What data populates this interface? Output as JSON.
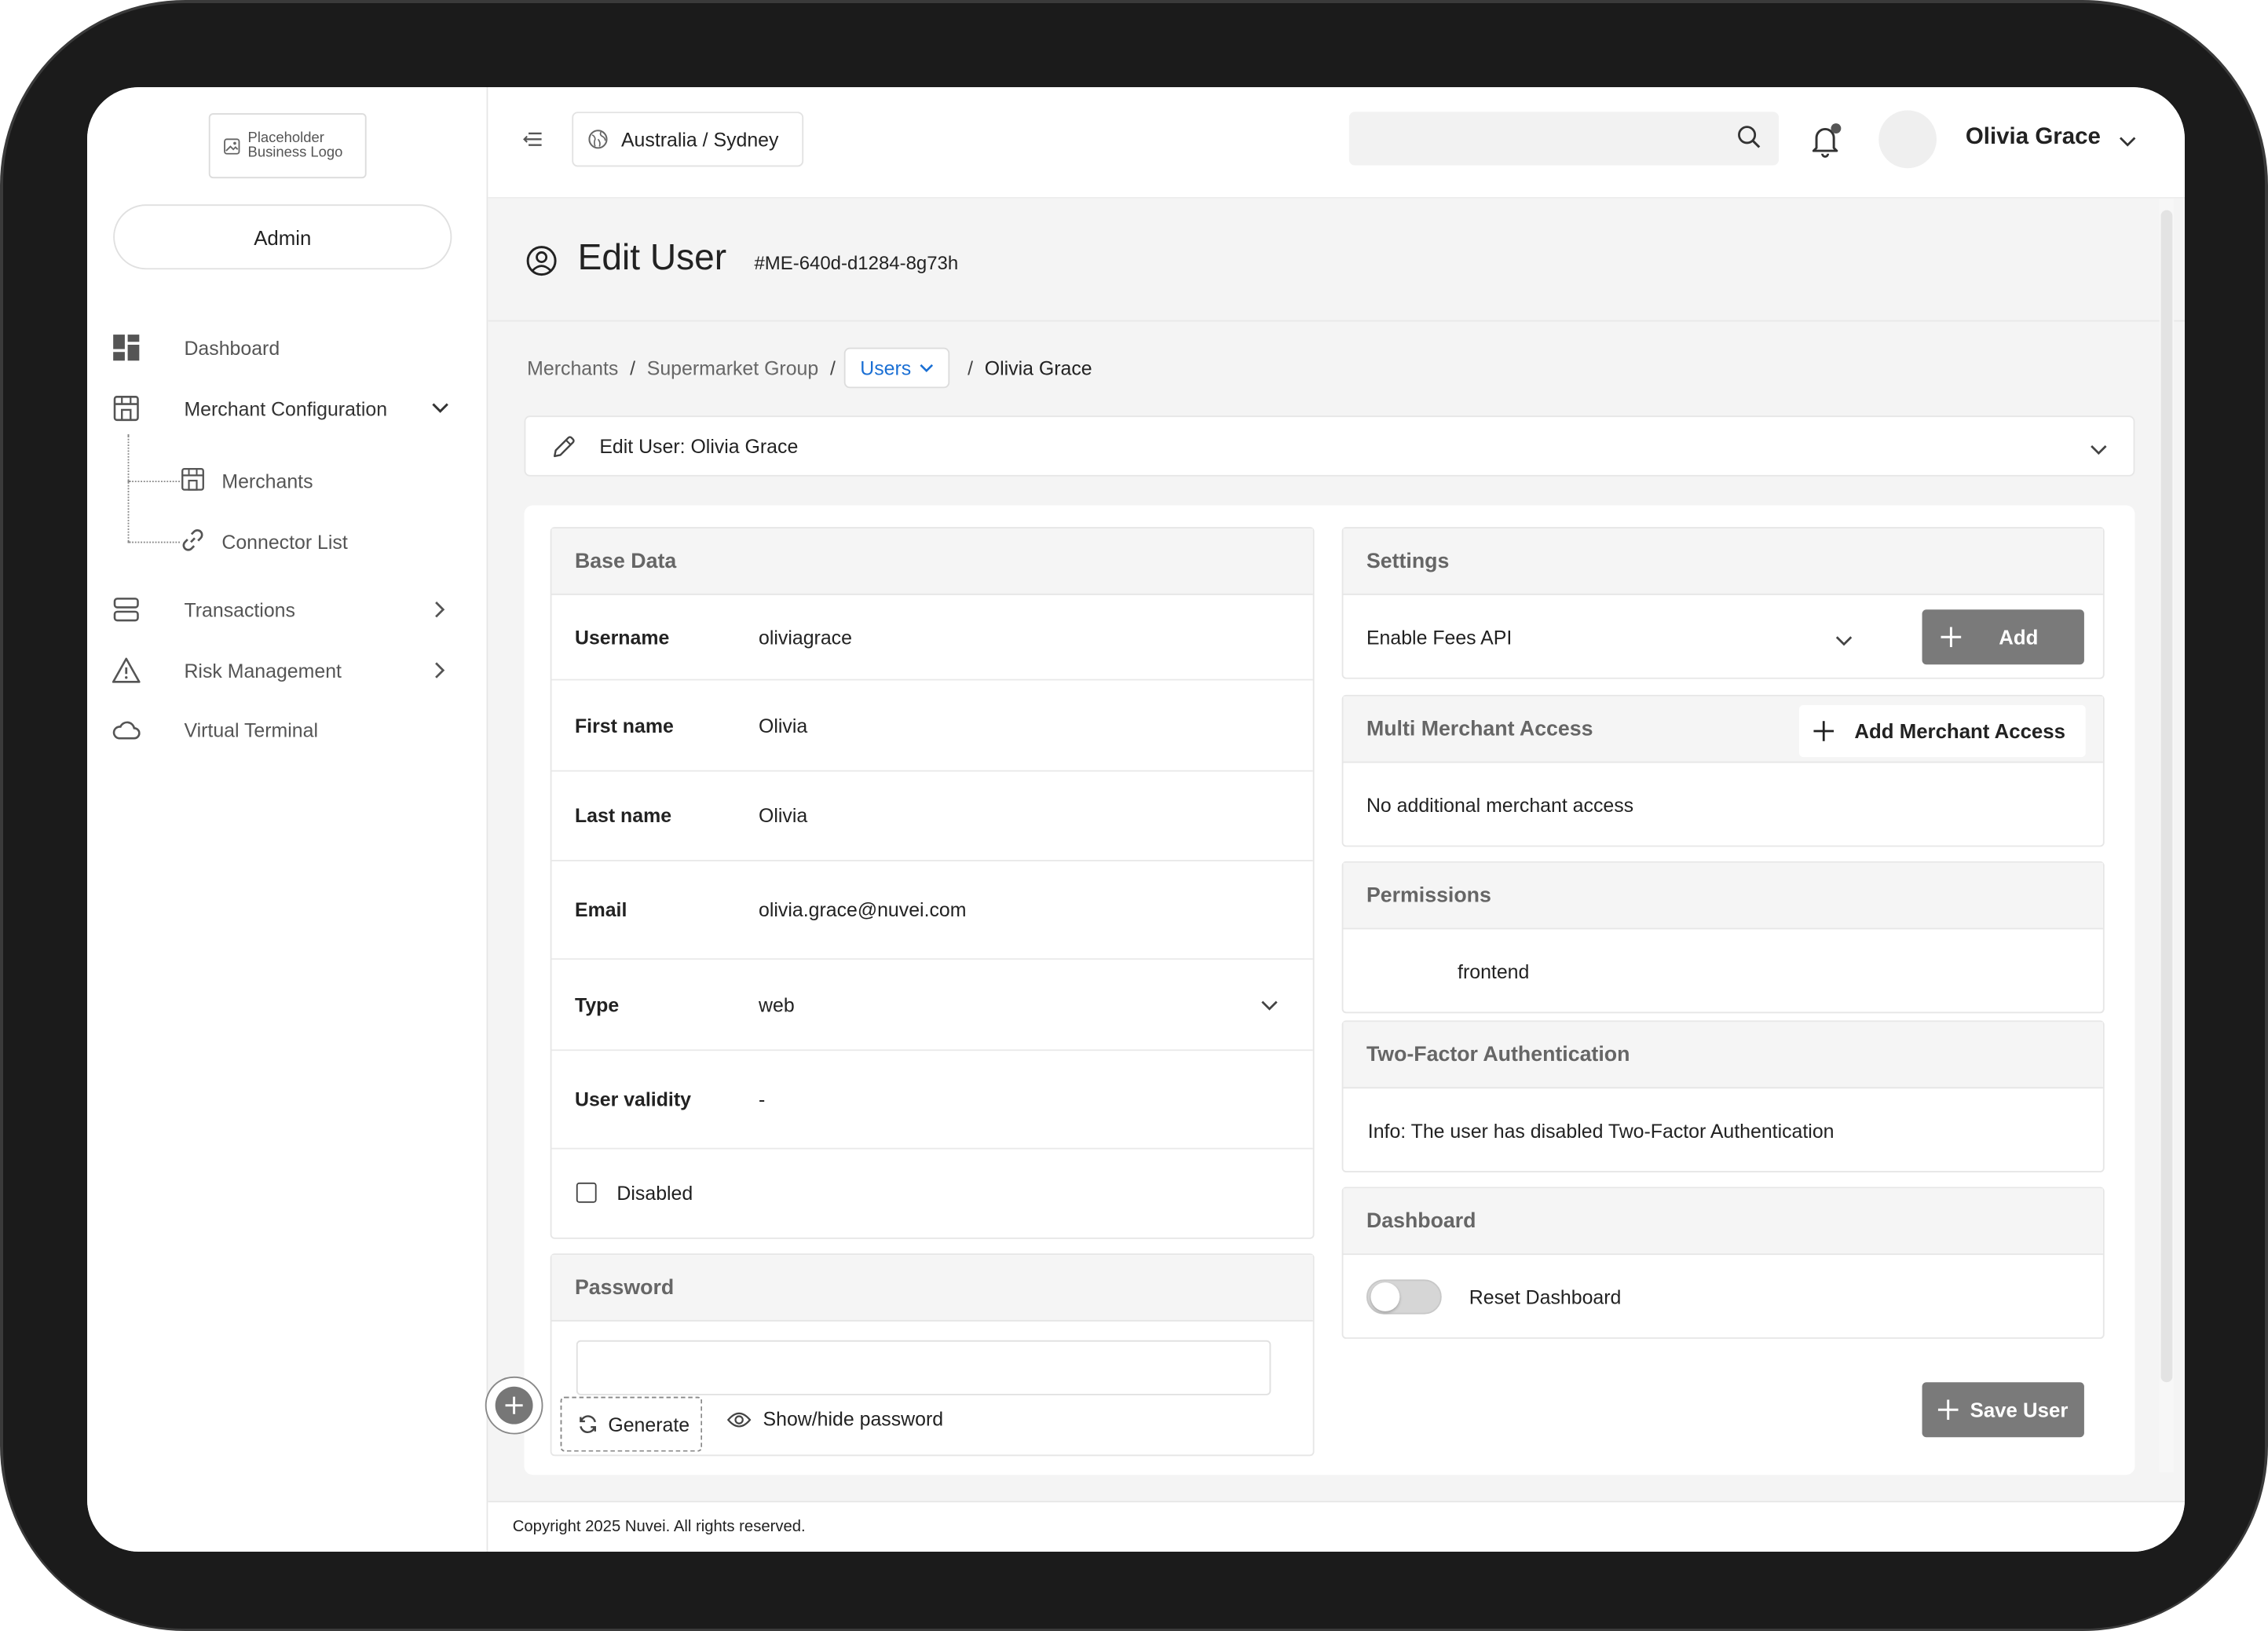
{
  "sidebar": {
    "logo_line1": "Placeholder",
    "logo_line2": "Business Logo",
    "role_label": "Admin",
    "items": [
      {
        "label": "Dashboard"
      },
      {
        "label": "Merchant Configuration"
      },
      {
        "label": "Transactions"
      },
      {
        "label": "Risk Management"
      },
      {
        "label": "Virtual Terminal"
      }
    ],
    "sub_items": [
      {
        "label": "Merchants"
      },
      {
        "label": "Connector List"
      }
    ]
  },
  "topbar": {
    "timezone": "Australia / Sydney",
    "search_value": "",
    "user_name": "Olivia Grace"
  },
  "page": {
    "title": "Edit User",
    "id": "#ME-640d-d1284-8g73h",
    "breadcrumbs": {
      "c1": "Merchants",
      "c2": "Supermarket Group",
      "c3": "Users",
      "c4": "Olivia Grace",
      "sep": "/"
    },
    "accordion_label": "Edit User: Olivia Grace"
  },
  "base_data": {
    "title": "Base Data",
    "fields": [
      {
        "label": "Username",
        "value": "oliviagrace"
      },
      {
        "label": "First name",
        "value": "Olivia"
      },
      {
        "label": "Last name",
        "value": "Olivia"
      },
      {
        "label": "Email",
        "value": "olivia.grace@nuvei.com"
      },
      {
        "label": "Type",
        "value": "web"
      },
      {
        "label": "User validity",
        "value": "-"
      }
    ],
    "disabled_label": "Disabled"
  },
  "password": {
    "title": "Password",
    "value": "",
    "generate_label": "Generate",
    "showhide_label": "Show/hide password"
  },
  "settings": {
    "title": "Settings",
    "select_value": "Enable Fees API",
    "add_label": "Add"
  },
  "multi_merchant": {
    "title": "Multi Merchant Access",
    "add_label": "Add Merchant Access",
    "empty_text": "No additional merchant access"
  },
  "permissions": {
    "title": "Permissions",
    "items": [
      "frontend"
    ]
  },
  "twofa": {
    "title": "Two-Factor Authentication",
    "info": "Info: The user has disabled Two-Factor Authentication"
  },
  "dashboard_panel": {
    "title": "Dashboard",
    "toggle_label": "Reset Dashboard"
  },
  "save_label": "Save User",
  "footer_text": "Copyright 2025 Nuvei. All rights reserved."
}
